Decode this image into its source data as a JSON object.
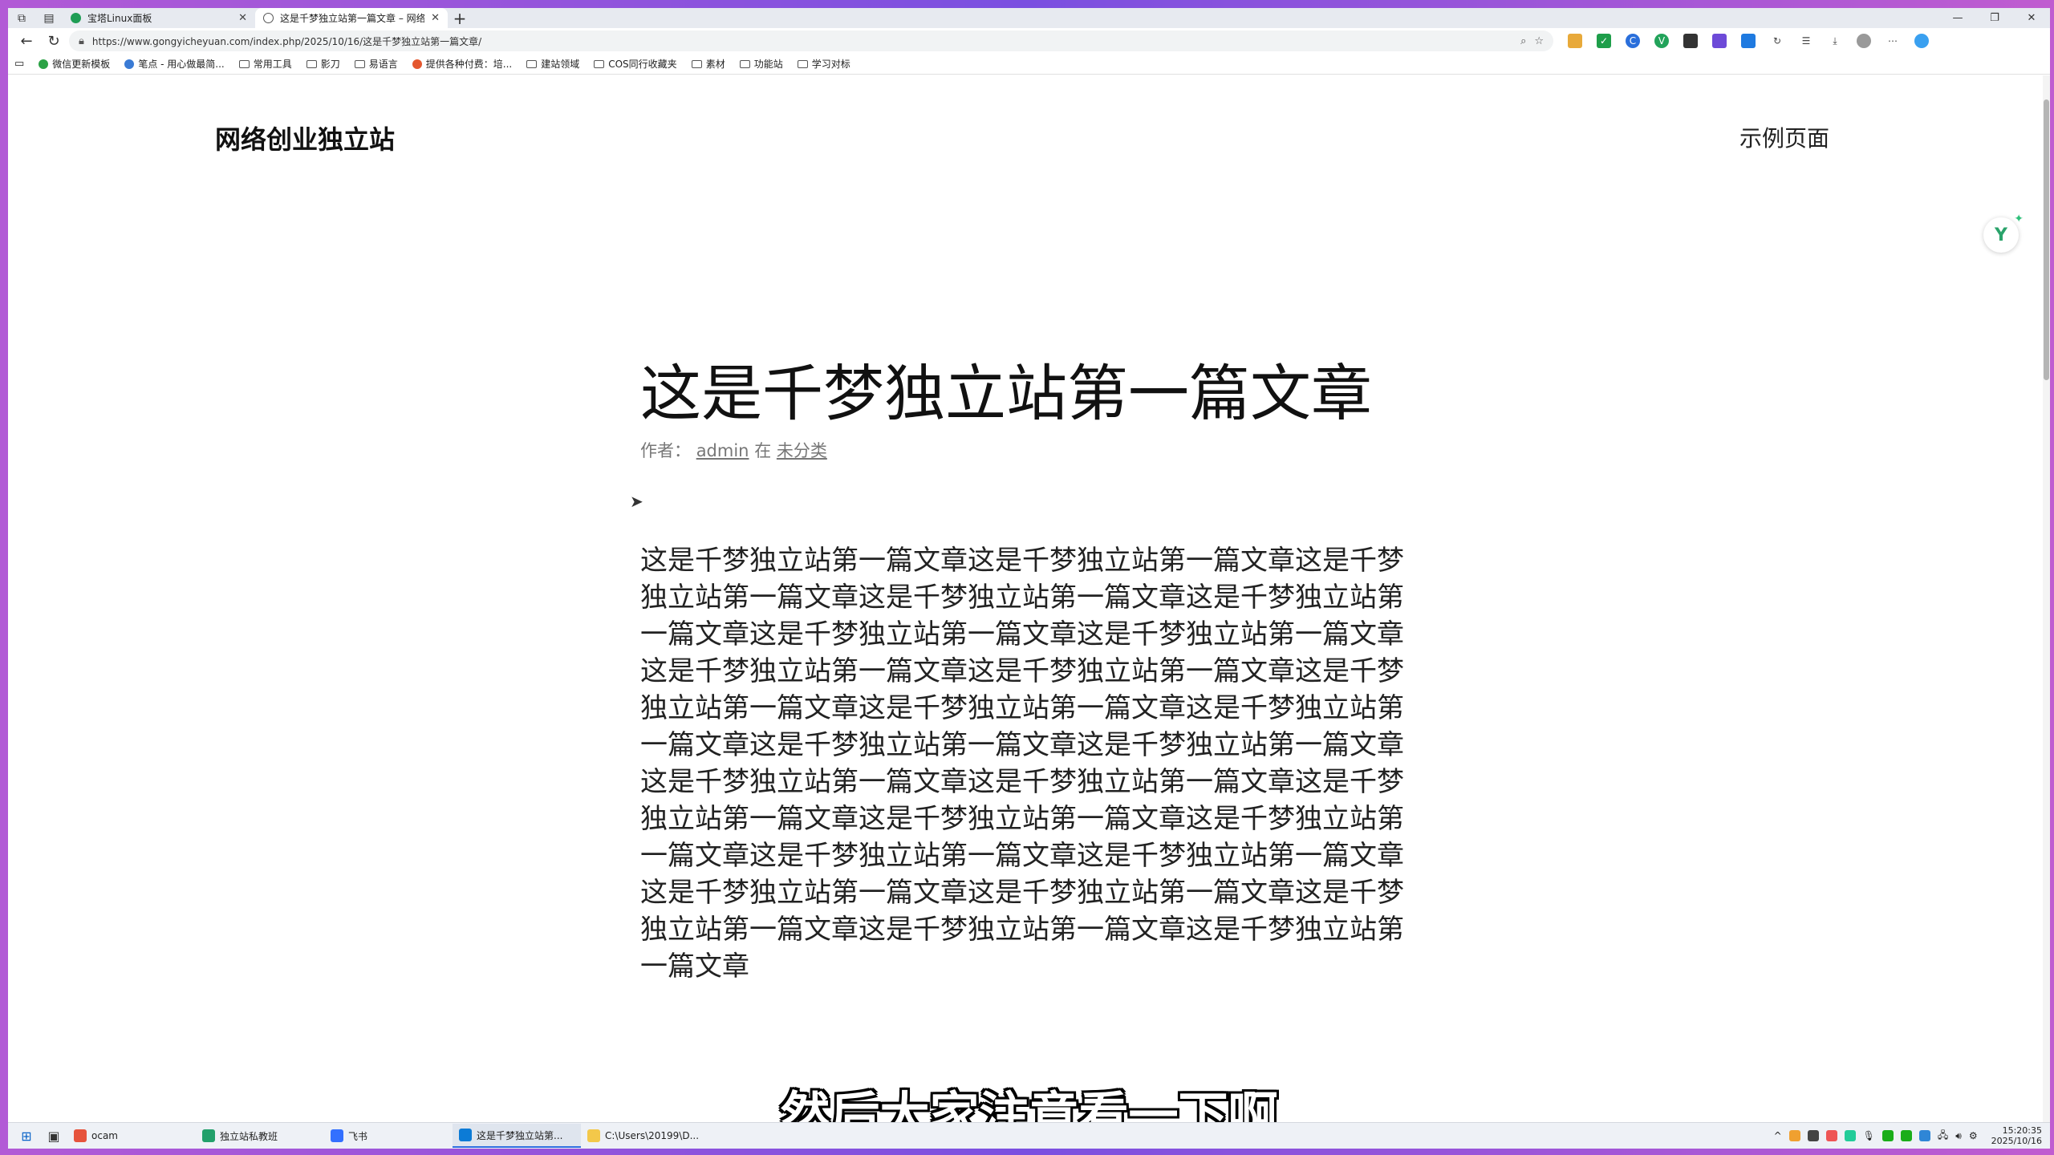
{
  "browser": {
    "tabs": [
      {
        "title": "宝塔Linux面板",
        "color": "#1f9d55"
      },
      {
        "title": "这是千梦独立站第一篇文章 – 网络",
        "color": "#1a73e8"
      }
    ],
    "url": "https://www.gongyicheyuan.com/index.php/2025/10/16/这是千梦独立站第一篇文章/"
  },
  "bookmarks": [
    {
      "label": "微信更新模板",
      "kind": "dot",
      "color": "#2ba245"
    },
    {
      "label": "笔点 - 用心做最简...",
      "kind": "dot",
      "color": "#3a7bd5"
    },
    {
      "label": "常用工具",
      "kind": "folder"
    },
    {
      "label": "影刀",
      "kind": "folder"
    },
    {
      "label": "易语言",
      "kind": "folder"
    },
    {
      "label": "提供各种付费：培...",
      "kind": "dot",
      "color": "#e4572e"
    },
    {
      "label": "建站领域",
      "kind": "folder"
    },
    {
      "label": "COS同行收藏夹",
      "kind": "folder"
    },
    {
      "label": "素材",
      "kind": "folder"
    },
    {
      "label": "功能站",
      "kind": "folder"
    },
    {
      "label": "学习对标",
      "kind": "folder"
    }
  ],
  "site": {
    "title": "网络创业独立站",
    "nav_item": "示例页面"
  },
  "post": {
    "title": "这是千梦独立站第一篇文章",
    "meta_prefix": "作者：",
    "author": "admin",
    "meta_mid": "在",
    "category": "未分类",
    "body": "这是千梦独立站第一篇文章这是千梦独立站第一篇文章这是千梦独立站第一篇文章这是千梦独立站第一篇文章这是千梦独立站第一篇文章这是千梦独立站第一篇文章这是千梦独立站第一篇文章这是千梦独立站第一篇文章这是千梦独立站第一篇文章这是千梦独立站第一篇文章这是千梦独立站第一篇文章这是千梦独立站第一篇文章这是千梦独立站第一篇文章这是千梦独立站第一篇文章这是千梦独立站第一篇文章这是千梦独立站第一篇文章这是千梦独立站第一篇文章这是千梦独立站第一篇文章这是千梦独立站第一篇文章这是千梦独立站第一篇文章这是千梦独立站第一篇文章这是千梦独立站第一篇文章这是千梦独立站第一篇文章这是千梦独立站第一篇文章这是千梦独立站第一篇文章这是千梦独立站第一篇文章"
  },
  "subtitle": "然后大家注意看一下啊",
  "taskbar": {
    "items": [
      {
        "label": "ocam",
        "color": "#e6533c"
      },
      {
        "label": "独立站私教班",
        "color": "#22a06b"
      },
      {
        "label": "飞书",
        "color": "#3370ff"
      },
      {
        "label": "这是千梦独立站第...",
        "color": "#0c7bd6"
      },
      {
        "label": "C:\\Users\\20199\\D...",
        "color": "#f3c84a"
      }
    ],
    "time": "15:20:35",
    "date": "2025/10/16"
  }
}
